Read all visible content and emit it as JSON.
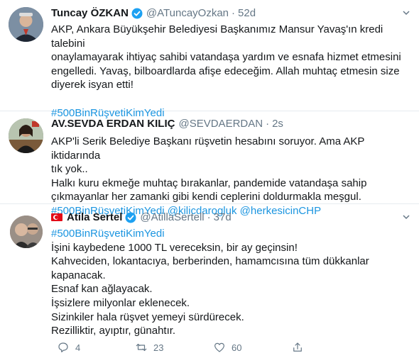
{
  "tweets": [
    {
      "name": "Tuncay ÖZKAN",
      "handle": "@ATuncayOzkan",
      "time": "52d",
      "verified": true,
      "lines": [
        "AKP, Ankara Büyükşehir Belediyesi Başkanımız Mansur Yavaş'ın kredi talebini",
        "onaylamayarak ihtiyaç sahibi vatandaşa yardım ve esnafa hizmet etmesini",
        "engelledi. Yavaş, bilboardlarda afişe edeceğim. Allah muhtaç etmesin size",
        "diyerek isyan etti!"
      ],
      "hashtag": "#500BinRüşvetiKimYedi"
    },
    {
      "name": "AV.SEVDA ERDAN KILIÇ",
      "handle": "@SEVDAERDAN",
      "time": "2s",
      "lines": [
        "AKP'li Serik Belediye Başkanı rüşvetin hesabını soruyor. Ama AKP iktidarında",
        "tık yok..",
        "Halkı kuru ekmeğe muhtaç bırakanlar, pandemide vatandaşa sahip",
        "çıkmayanlar her zamanki gibi kendi ceplerini doldurmakla meşgul."
      ],
      "tags": [
        "#500BinRüşvetiKimYedi",
        "@kilicdarogluk",
        "@herkesicinCHP"
      ]
    },
    {
      "name": "Atila Sertel",
      "handle": "@AtillaSertell",
      "time": "37d",
      "verified": true,
      "hashtag": "#500BinRüşvetiKimYedi",
      "lines": [
        "İşini kaybedene 1000 TL vereceksin, bir ay geçinsin!",
        "Kahveciden, lokantacıya, berberinden, hamamcısına tüm dükkanlar",
        "kapanacak.",
        "Esnaf kan ağlayacak.",
        "İşsizlere milyonlar eklenecek.",
        "Sizinkiler hala rüşvet yemeyi sürdürecek.",
        "Rezilliktir, ayıptır, günahtır."
      ],
      "actions": {
        "reply_count": "4",
        "retweet_count": "23",
        "like_count": "60"
      }
    }
  ],
  "colors": {
    "link": "#1b95e0",
    "secondary": "#657786",
    "verified": "#1da1f2",
    "divider": "#e6ecf0"
  },
  "icons": {
    "reply": "reply-icon",
    "retweet": "retweet-icon",
    "like": "heart-icon",
    "share": "share-icon",
    "menu": "chevron-down-icon"
  }
}
